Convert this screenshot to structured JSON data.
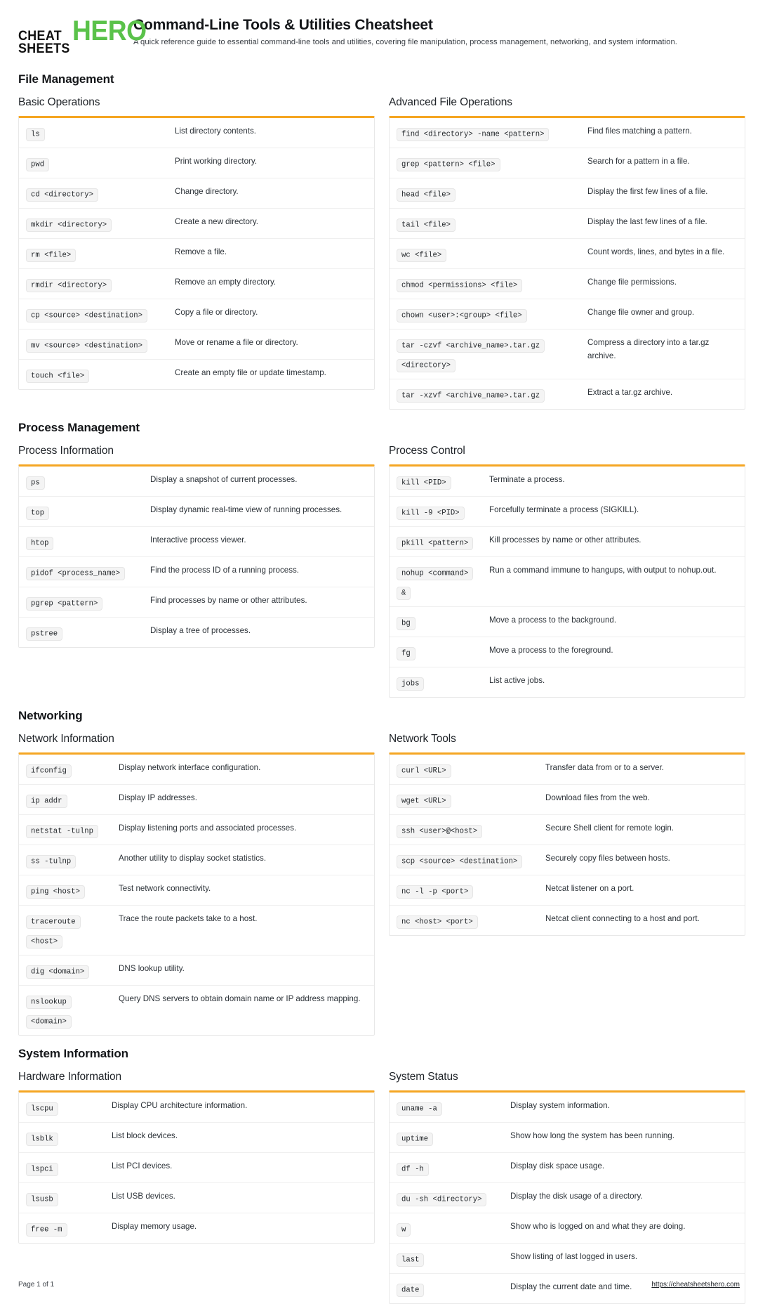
{
  "brand": {
    "line1": "CHEAT",
    "line2": "SHEETS",
    "hero": "HERO",
    "hero_color": "#5ac24a"
  },
  "header": {
    "title": "Command-Line Tools & Utilities Cheatsheet",
    "subtitle": "A quick reference guide to essential command-line tools and utilities, covering file manipulation, process management, networking, and system information."
  },
  "accent_color": "#F5A623",
  "sections": [
    {
      "title": "File Management",
      "tables": [
        {
          "title": "Basic Operations",
          "rows": [
            {
              "command": "ls",
              "description": "List directory contents."
            },
            {
              "command": "pwd",
              "description": "Print working directory."
            },
            {
              "command": "cd <directory>",
              "description": "Change directory."
            },
            {
              "command": "mkdir <directory>",
              "description": "Create a new directory."
            },
            {
              "command": "rm <file>",
              "description": "Remove a file."
            },
            {
              "command": "rmdir <directory>",
              "description": "Remove an empty directory."
            },
            {
              "command": "cp <source> <destination>",
              "description": "Copy a file or directory."
            },
            {
              "command": "mv <source> <destination>",
              "description": "Move or rename a file or directory."
            },
            {
              "command": "touch <file>",
              "description": "Create an empty file or update timestamp."
            }
          ]
        },
        {
          "title": "Advanced File Operations",
          "rows": [
            {
              "command": "find <directory> -name <pattern>",
              "description": "Find files matching a pattern."
            },
            {
              "command": "grep <pattern> <file>",
              "description": "Search for a pattern in a file."
            },
            {
              "command": "head <file>",
              "description": "Display the first few lines of a file."
            },
            {
              "command": "tail <file>",
              "description": "Display the last few lines of a file."
            },
            {
              "command": "wc <file>",
              "description": "Count words, lines, and bytes in a file."
            },
            {
              "command": "chmod <permissions> <file>",
              "description": "Change file permissions."
            },
            {
              "command": "chown <user>:<group> <file>",
              "description": "Change file owner and group."
            },
            {
              "command": "tar -czvf <archive_name>.tar.gz <directory>",
              "description": "Compress a directory into a tar.gz archive."
            },
            {
              "command": "tar -xzvf <archive_name>.tar.gz",
              "description": "Extract a tar.gz archive."
            }
          ]
        }
      ]
    },
    {
      "title": "Process Management",
      "tables": [
        {
          "title": "Process Information",
          "rows": [
            {
              "command": "ps",
              "description": "Display a snapshot of current processes."
            },
            {
              "command": "top",
              "description": "Display dynamic real-time view of running processes."
            },
            {
              "command": "htop",
              "description": "Interactive process viewer."
            },
            {
              "command": "pidof <process_name>",
              "description": "Find the process ID of a running process."
            },
            {
              "command": "pgrep <pattern>",
              "description": "Find processes by name or other attributes."
            },
            {
              "command": "pstree",
              "description": "Display a tree of processes."
            }
          ]
        },
        {
          "title": "Process Control",
          "rows": [
            {
              "command": "kill <PID>",
              "description": "Terminate a process."
            },
            {
              "command": "kill -9 <PID>",
              "description": "Forcefully terminate a process (SIGKILL)."
            },
            {
              "command": "pkill <pattern>",
              "description": "Kill processes by name or other attributes."
            },
            {
              "command": "nohup <command> &",
              "description": "Run a command immune to hangups, with output to nohup.out."
            },
            {
              "command": "bg",
              "description": "Move a process to the background."
            },
            {
              "command": "fg",
              "description": "Move a process to the foreground."
            },
            {
              "command": "jobs",
              "description": "List active jobs."
            }
          ]
        }
      ]
    },
    {
      "title": "Networking",
      "tables": [
        {
          "title": "Network Information",
          "rows": [
            {
              "command": "ifconfig",
              "description": "Display network interface configuration."
            },
            {
              "command": "ip addr",
              "description": "Display IP addresses."
            },
            {
              "command": "netstat -tulnp",
              "description": "Display listening ports and associated processes."
            },
            {
              "command": "ss -tulnp",
              "description": "Another utility to display socket statistics."
            },
            {
              "command": "ping <host>",
              "description": "Test network connectivity."
            },
            {
              "command": "traceroute <host>",
              "description": "Trace the route packets take to a host."
            },
            {
              "command": "dig <domain>",
              "description": "DNS lookup utility."
            },
            {
              "command": "nslookup <domain>",
              "description": "Query DNS servers to obtain domain name or IP address mapping."
            }
          ]
        },
        {
          "title": "Network Tools",
          "rows": [
            {
              "command": "curl <URL>",
              "description": "Transfer data from or to a server."
            },
            {
              "command": "wget <URL>",
              "description": "Download files from the web."
            },
            {
              "command": "ssh <user>@<host>",
              "description": "Secure Shell client for remote login."
            },
            {
              "command": "scp <source> <destination>",
              "description": "Securely copy files between hosts."
            },
            {
              "command": "nc -l -p <port>",
              "description": "Netcat listener on a port."
            },
            {
              "command": "nc <host> <port>",
              "description": "Netcat client connecting to a host and port."
            }
          ]
        }
      ]
    },
    {
      "title": "System Information",
      "tables": [
        {
          "title": "Hardware Information",
          "rows": [
            {
              "command": "lscpu",
              "description": "Display CPU architecture information."
            },
            {
              "command": "lsblk",
              "description": "List block devices."
            },
            {
              "command": "lspci",
              "description": "List PCI devices."
            },
            {
              "command": "lsusb",
              "description": "List USB devices."
            },
            {
              "command": "free -m",
              "description": "Display memory usage."
            }
          ]
        },
        {
          "title": "System Status",
          "rows": [
            {
              "command": "uname -a",
              "description": "Display system information."
            },
            {
              "command": "uptime",
              "description": "Show how long the system has been running."
            },
            {
              "command": "df -h",
              "description": "Display disk space usage."
            },
            {
              "command": "du -sh <directory>",
              "description": "Display the disk usage of a directory."
            },
            {
              "command": "w",
              "description": "Show who is logged on and what they are doing."
            },
            {
              "command": "last",
              "description": "Show listing of last logged in users."
            },
            {
              "command": "date",
              "description": "Display the current date and time."
            }
          ]
        }
      ]
    }
  ],
  "footer": {
    "page_label": "Page 1 of 1",
    "site_url": "https://cheatsheetshero.com"
  }
}
